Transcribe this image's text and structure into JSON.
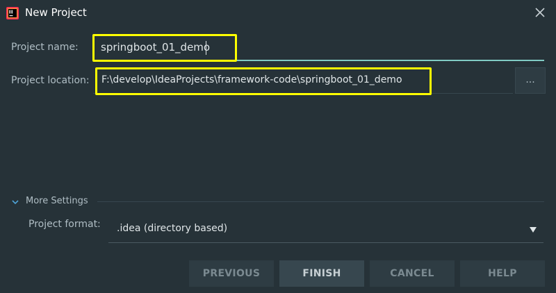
{
  "window": {
    "title": "New Project",
    "app_icon": "intellij-idea-icon",
    "close_icon": "close-icon"
  },
  "form": {
    "project_name_label": "Project name:",
    "project_name_value": "springboot_01_demo",
    "project_location_label": "Project location:",
    "project_location_value": "F:\\develop\\IdeaProjects\\framework-code\\springboot_01_demo",
    "browse_label": "...",
    "more_settings_label": "More Settings",
    "project_format_label": "Project format:",
    "project_format_value": ".idea (directory based)"
  },
  "buttons": {
    "previous": "PREVIOUS",
    "finish": "FINISH",
    "cancel": "CANCEL",
    "help": "HELP"
  },
  "colors": {
    "background": "#263238",
    "focus_underline": "#80cbc4",
    "annotation_highlight": "#ffff00"
  }
}
